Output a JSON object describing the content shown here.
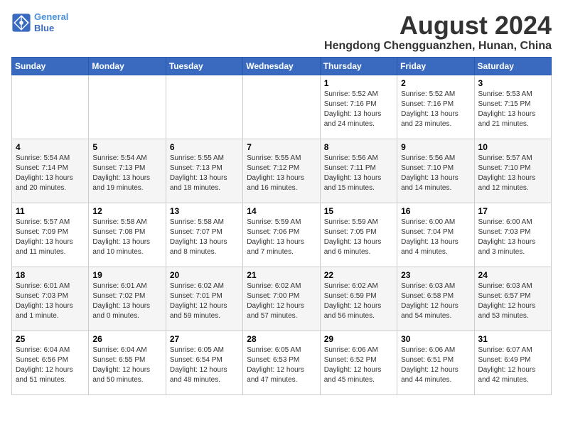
{
  "logo": {
    "line1": "General",
    "line2": "Blue"
  },
  "title": "August 2024",
  "subtitle": "Hengdong Chengguanzhen, Hunan, China",
  "days_of_week": [
    "Sunday",
    "Monday",
    "Tuesday",
    "Wednesday",
    "Thursday",
    "Friday",
    "Saturday"
  ],
  "weeks": [
    [
      {
        "day": "",
        "info": ""
      },
      {
        "day": "",
        "info": ""
      },
      {
        "day": "",
        "info": ""
      },
      {
        "day": "",
        "info": ""
      },
      {
        "day": "1",
        "info": "Sunrise: 5:52 AM\nSunset: 7:16 PM\nDaylight: 13 hours\nand 24 minutes."
      },
      {
        "day": "2",
        "info": "Sunrise: 5:52 AM\nSunset: 7:16 PM\nDaylight: 13 hours\nand 23 minutes."
      },
      {
        "day": "3",
        "info": "Sunrise: 5:53 AM\nSunset: 7:15 PM\nDaylight: 13 hours\nand 21 minutes."
      }
    ],
    [
      {
        "day": "4",
        "info": "Sunrise: 5:54 AM\nSunset: 7:14 PM\nDaylight: 13 hours\nand 20 minutes."
      },
      {
        "day": "5",
        "info": "Sunrise: 5:54 AM\nSunset: 7:13 PM\nDaylight: 13 hours\nand 19 minutes."
      },
      {
        "day": "6",
        "info": "Sunrise: 5:55 AM\nSunset: 7:13 PM\nDaylight: 13 hours\nand 18 minutes."
      },
      {
        "day": "7",
        "info": "Sunrise: 5:55 AM\nSunset: 7:12 PM\nDaylight: 13 hours\nand 16 minutes."
      },
      {
        "day": "8",
        "info": "Sunrise: 5:56 AM\nSunset: 7:11 PM\nDaylight: 13 hours\nand 15 minutes."
      },
      {
        "day": "9",
        "info": "Sunrise: 5:56 AM\nSunset: 7:10 PM\nDaylight: 13 hours\nand 14 minutes."
      },
      {
        "day": "10",
        "info": "Sunrise: 5:57 AM\nSunset: 7:10 PM\nDaylight: 13 hours\nand 12 minutes."
      }
    ],
    [
      {
        "day": "11",
        "info": "Sunrise: 5:57 AM\nSunset: 7:09 PM\nDaylight: 13 hours\nand 11 minutes."
      },
      {
        "day": "12",
        "info": "Sunrise: 5:58 AM\nSunset: 7:08 PM\nDaylight: 13 hours\nand 10 minutes."
      },
      {
        "day": "13",
        "info": "Sunrise: 5:58 AM\nSunset: 7:07 PM\nDaylight: 13 hours\nand 8 minutes."
      },
      {
        "day": "14",
        "info": "Sunrise: 5:59 AM\nSunset: 7:06 PM\nDaylight: 13 hours\nand 7 minutes."
      },
      {
        "day": "15",
        "info": "Sunrise: 5:59 AM\nSunset: 7:05 PM\nDaylight: 13 hours\nand 6 minutes."
      },
      {
        "day": "16",
        "info": "Sunrise: 6:00 AM\nSunset: 7:04 PM\nDaylight: 13 hours\nand 4 minutes."
      },
      {
        "day": "17",
        "info": "Sunrise: 6:00 AM\nSunset: 7:03 PM\nDaylight: 13 hours\nand 3 minutes."
      }
    ],
    [
      {
        "day": "18",
        "info": "Sunrise: 6:01 AM\nSunset: 7:03 PM\nDaylight: 13 hours\nand 1 minute."
      },
      {
        "day": "19",
        "info": "Sunrise: 6:01 AM\nSunset: 7:02 PM\nDaylight: 13 hours\nand 0 minutes."
      },
      {
        "day": "20",
        "info": "Sunrise: 6:02 AM\nSunset: 7:01 PM\nDaylight: 12 hours\nand 59 minutes."
      },
      {
        "day": "21",
        "info": "Sunrise: 6:02 AM\nSunset: 7:00 PM\nDaylight: 12 hours\nand 57 minutes."
      },
      {
        "day": "22",
        "info": "Sunrise: 6:02 AM\nSunset: 6:59 PM\nDaylight: 12 hours\nand 56 minutes."
      },
      {
        "day": "23",
        "info": "Sunrise: 6:03 AM\nSunset: 6:58 PM\nDaylight: 12 hours\nand 54 minutes."
      },
      {
        "day": "24",
        "info": "Sunrise: 6:03 AM\nSunset: 6:57 PM\nDaylight: 12 hours\nand 53 minutes."
      }
    ],
    [
      {
        "day": "25",
        "info": "Sunrise: 6:04 AM\nSunset: 6:56 PM\nDaylight: 12 hours\nand 51 minutes."
      },
      {
        "day": "26",
        "info": "Sunrise: 6:04 AM\nSunset: 6:55 PM\nDaylight: 12 hours\nand 50 minutes."
      },
      {
        "day": "27",
        "info": "Sunrise: 6:05 AM\nSunset: 6:54 PM\nDaylight: 12 hours\nand 48 minutes."
      },
      {
        "day": "28",
        "info": "Sunrise: 6:05 AM\nSunset: 6:53 PM\nDaylight: 12 hours\nand 47 minutes."
      },
      {
        "day": "29",
        "info": "Sunrise: 6:06 AM\nSunset: 6:52 PM\nDaylight: 12 hours\nand 45 minutes."
      },
      {
        "day": "30",
        "info": "Sunrise: 6:06 AM\nSunset: 6:51 PM\nDaylight: 12 hours\nand 44 minutes."
      },
      {
        "day": "31",
        "info": "Sunrise: 6:07 AM\nSunset: 6:49 PM\nDaylight: 12 hours\nand 42 minutes."
      }
    ]
  ]
}
